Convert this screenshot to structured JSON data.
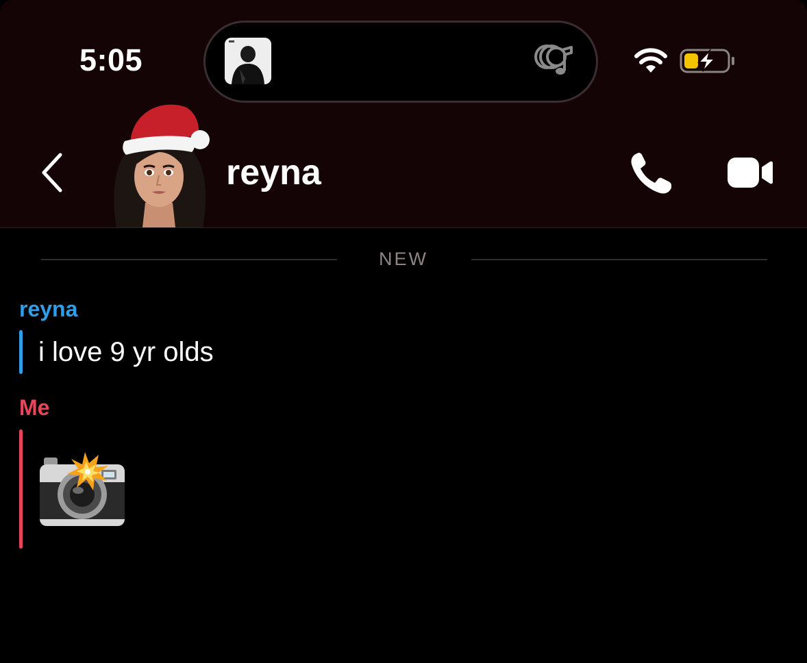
{
  "status_bar": {
    "time": "5:05",
    "wifi_icon": "wifi-icon",
    "battery_icon": "battery-charging-icon",
    "battery_color": "#f5c400"
  },
  "dynamic_island": {
    "album_art_icon": "album-art",
    "app_icon": "music-icon"
  },
  "header": {
    "back_icon": "chevron-left-icon",
    "avatar_icon": "bitmoji-avatar",
    "contact_name": "reyna",
    "call_icon": "phone-icon",
    "video_icon": "video-camera-icon",
    "background_color": "#150405"
  },
  "chat": {
    "divider_label": "NEW",
    "messages": [
      {
        "sender": "reyna",
        "sender_color": "#2f9ee8",
        "text": "i love 9 yr olds"
      },
      {
        "sender": "Me",
        "sender_color": "#e8455a",
        "attachment_icon": "camera-with-flash-emoji"
      }
    ]
  }
}
